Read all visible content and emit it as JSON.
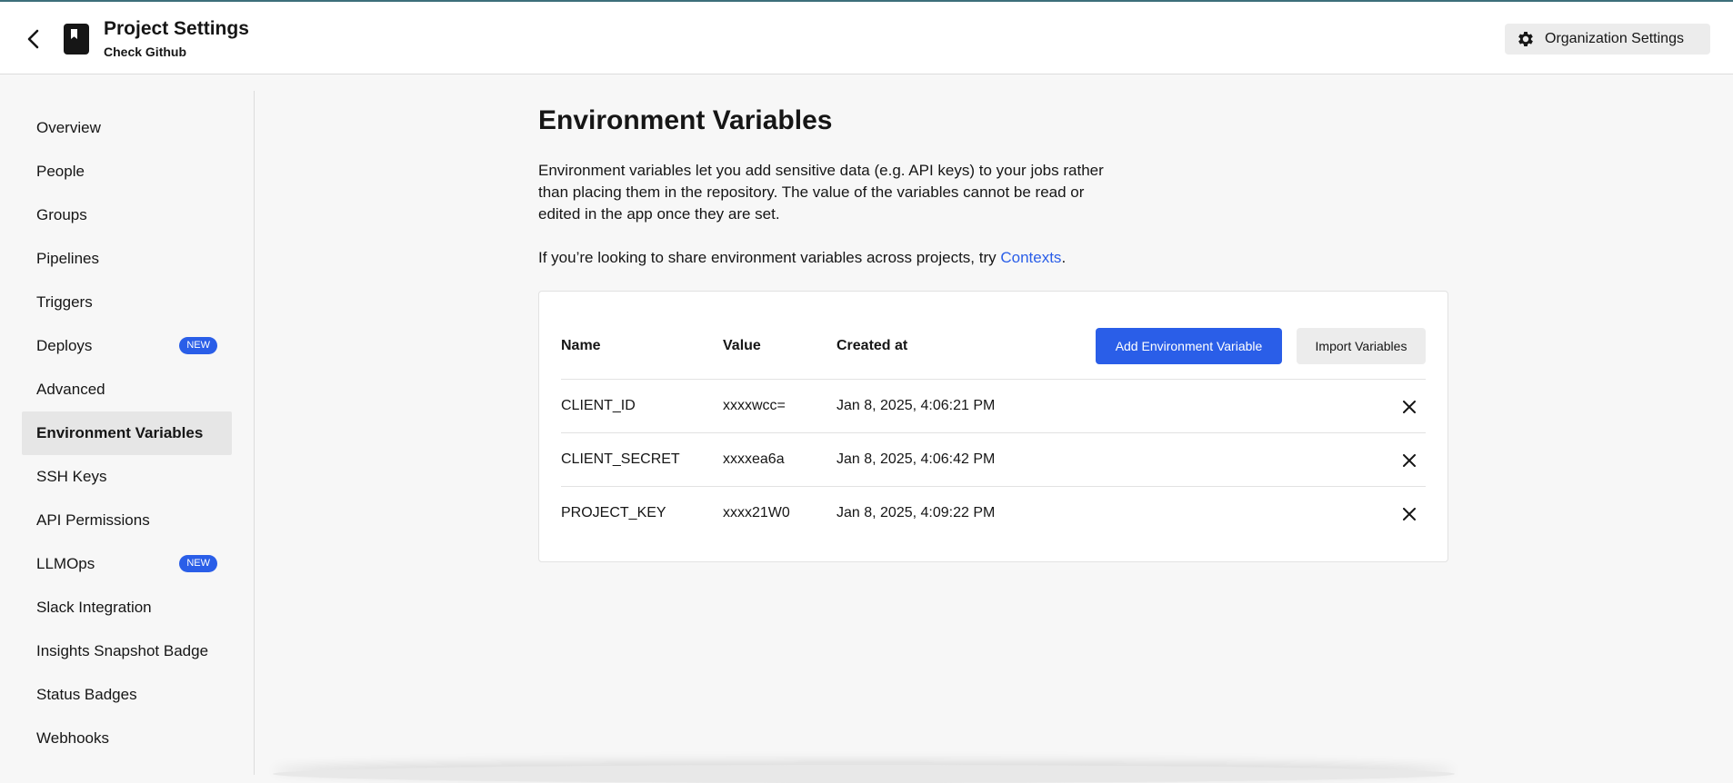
{
  "header": {
    "title": "Project Settings",
    "subtitle": "Check Github",
    "org_settings_label": "Organization Settings"
  },
  "sidebar": {
    "items": [
      {
        "label": "Overview"
      },
      {
        "label": "People"
      },
      {
        "label": "Groups"
      },
      {
        "label": "Pipelines"
      },
      {
        "label": "Triggers"
      },
      {
        "label": "Deploys",
        "badge": "NEW"
      },
      {
        "label": "Advanced"
      },
      {
        "label": "Environment Variables",
        "active": true
      },
      {
        "label": "SSH Keys"
      },
      {
        "label": "API Permissions"
      },
      {
        "label": "LLMOps",
        "badge": "NEW"
      },
      {
        "label": "Slack Integration"
      },
      {
        "label": "Insights Snapshot Badge"
      },
      {
        "label": "Status Badges"
      },
      {
        "label": "Webhooks"
      }
    ]
  },
  "main": {
    "title": "Environment Variables",
    "description": "Environment variables let you add sensitive data (e.g. API keys) to your jobs rather than placing them in the repository. The value of the variables cannot be read or edited in the app once they are set.",
    "share_text": "If you’re looking to share environment variables across projects, try ",
    "contexts_link": "Contexts",
    "share_suffix": "."
  },
  "table": {
    "headers": {
      "name": "Name",
      "value": "Value",
      "created": "Created at"
    },
    "add_button": "Add Environment Variable",
    "import_button": "Import Variables",
    "rows": [
      {
        "name": "CLIENT_ID",
        "value": "xxxxwcc=",
        "created": "Jan 8, 2025, 4:06:21 PM"
      },
      {
        "name": "CLIENT_SECRET",
        "value": "xxxxea6a",
        "created": "Jan 8, 2025, 4:06:42 PM"
      },
      {
        "name": "PROJECT_KEY",
        "value": "xxxx21W0",
        "created": "Jan 8, 2025, 4:09:22 PM"
      }
    ]
  },
  "colors": {
    "accent": "#2a5ee8",
    "background": "#f7f7f7"
  }
}
